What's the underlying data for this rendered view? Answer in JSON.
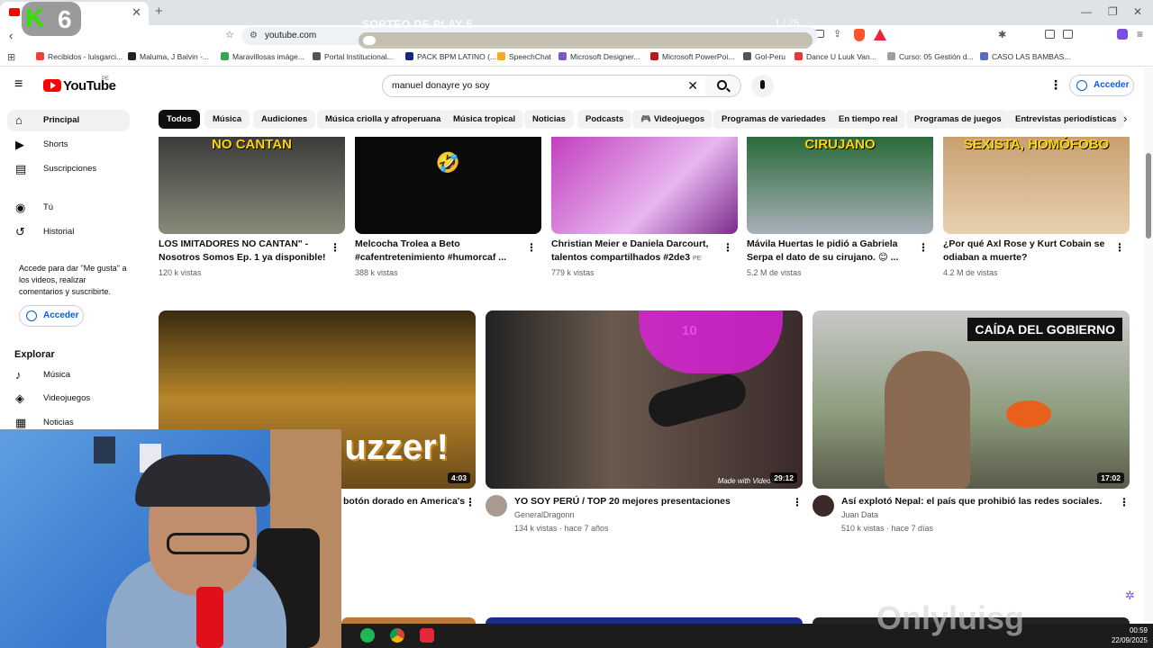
{
  "browser": {
    "tab_close": "✕",
    "new_tab": "+",
    "url": "youtube.com",
    "bookmarks": [
      {
        "label": "Recibidos - luisgarci...",
        "color": "#ea4335"
      },
      {
        "label": "Maluma, J Balvin -...",
        "color": "#222222"
      },
      {
        "label": "Maravillosas imáge...",
        "color": "#34a853"
      },
      {
        "label": "Portal Institucional...",
        "color": "#555555"
      },
      {
        "label": "PACK BPM LATINO (...",
        "color": "#1a237e"
      },
      {
        "label": "SpeechChat",
        "color": "#f9a825"
      },
      {
        "label": "Microsoft Designer...",
        "color": "#7e57c2"
      },
      {
        "label": "Microsoft PowerPoi...",
        "color": "#b71c1c"
      },
      {
        "label": "Gol-Peru",
        "color": "#555555"
      },
      {
        "label": "Dance U Luuk Van...",
        "color": "#e53935"
      },
      {
        "label": "Curso: 05 Gestión d...",
        "color": "#9e9e9e"
      },
      {
        "label": "CASO LAS BAMBAS...",
        "color": "#5c6bc0"
      }
    ]
  },
  "overlay": {
    "k_letter": "K",
    "k_number": "6",
    "sorteo": "SORTEO DE PLAY 5",
    "counter": "1 / 25"
  },
  "youtube": {
    "logo_text": "YouTube",
    "country": "PE",
    "search_value": "manuel donayre yo soy",
    "acceder": "Acceder",
    "chips": [
      "Todos",
      "Música",
      "Audiciones",
      "Música criolla y afroperuana",
      "Música tropical",
      "Noticias",
      "Podcasts",
      "Videojuegos",
      "Programas de variedades",
      "En tiempo real",
      "Programas de juegos",
      "Entrevistas periodísticas"
    ],
    "sidebar": {
      "items": [
        "Principal",
        "Shorts",
        "Suscripciones",
        "Tú",
        "Historial"
      ],
      "note": "Accede para dar \"Me gusta\" a los videos, realizar comentarios y suscribirte.",
      "acceder": "Acceder",
      "explorar": "Explorar",
      "explore_items": [
        "Música",
        "Videojuegos",
        "Noticias"
      ]
    },
    "row1": [
      {
        "thumb_text": "NO CANTAN",
        "title1": "LOS IMITADORES NO CANTAN\" -",
        "title2": "Nosotros Somos Ep. 1 ya disponible!",
        "meta": "120 k vistas"
      },
      {
        "thumb_text": "🤣",
        "title1": "Melcocha Trolea a Beto",
        "title2": "#cafentretenimiento #humorcaf ...",
        "meta": "388 k vistas"
      },
      {
        "thumb_text": "",
        "title1": "Christian Meier e Daniela Darcourt,",
        "title2": "talentos compartilhados #2de3",
        "title2_badge": "PE",
        "meta": "779 k vistas"
      },
      {
        "thumb_text": "CIRUJANO",
        "title1": "Mávila Huertas le pidió a Gabriela",
        "title2": "Serpa el dato de su cirujano. 😊 ...",
        "meta": "5.2 M de vistas"
      },
      {
        "thumb_text": "SEXISTA, HOMÓFOBO",
        "title1": "¿Por qué Axl Rose y Kurt Cobain se",
        "title2": "odiaban a muerte?",
        "meta": "4.2 M de vistas"
      }
    ],
    "row2": [
      {
        "thumb_text": "uzzer!",
        "duration": "4:03",
        "title": "botón dorado en America's",
        "channel": "",
        "meta": ""
      },
      {
        "thumb_text": "10",
        "thumb_tag": "Made with VideoS",
        "duration": "29:12",
        "title": "YO SOY PERÚ / TOP 20 mejores presentaciones",
        "channel": "GeneralDragonn",
        "meta": "134 k vistas · hace 7 años"
      },
      {
        "thumb_text": "CAÍDA DEL GOBIERNO",
        "duration": "17:02",
        "title": "Así explotó Nepal: el país que prohibió las redes sociales.",
        "channel": "Juan Data",
        "meta": "510 k vistas · hace 7 días"
      }
    ]
  },
  "taskbar": {
    "time": "00:59",
    "date": "22/09/2025"
  },
  "watermark": "Onlyluisg",
  "colors": {
    "accent": "#065fd4",
    "brand_red": "#ff0000"
  }
}
